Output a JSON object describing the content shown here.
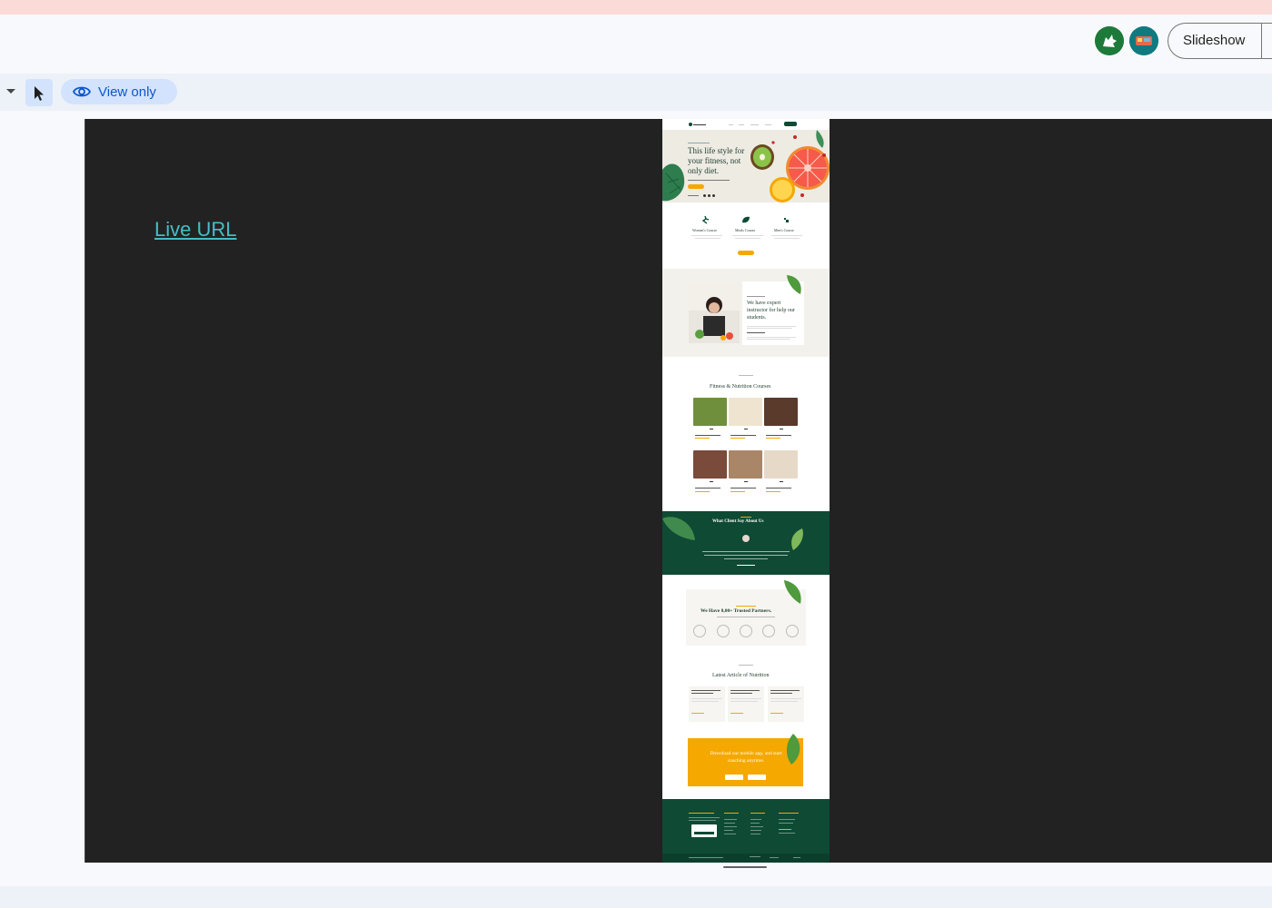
{
  "header": {
    "slideshow_label": "Slideshow"
  },
  "toolbar": {
    "view_only_label": "View only"
  },
  "slide": {
    "link_text": "Live URL"
  },
  "mock_page": {
    "hero_title": "This life style for your fitness, not only diet.",
    "services": [
      "Women's Course",
      "Meals Course",
      "Men's Course"
    ],
    "instructor_title": "We have expert instructor for help our students.",
    "courses_title": "Fitness & Nutrition Courses",
    "testimonial_title": "What Client Say About Us",
    "partners_title": "We Have 8,00+ Trusted Partners.",
    "articles_title": "Latest Article of Nutrition",
    "app_title": "Download our mobile app, and start coaching anytime."
  },
  "colors": {
    "accent_blue": "#0b57d0",
    "link_teal": "#46bdc6",
    "mock_green": "#0e4a34",
    "mock_yellow": "#f5a800"
  },
  "icons": [
    "eye-icon",
    "select-cursor-icon",
    "caret-down-icon",
    "avatar-icon"
  ]
}
